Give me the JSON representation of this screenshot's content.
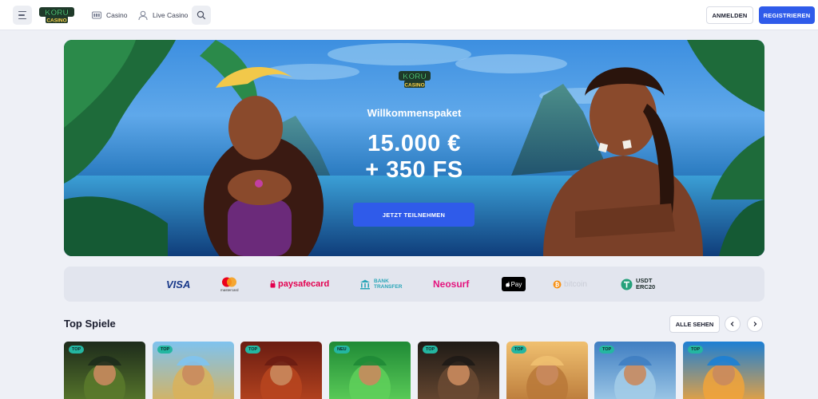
{
  "header": {
    "logo_text": "KORU CASINO",
    "nav": [
      {
        "label": "Casino",
        "icon": "slot-machine-icon"
      },
      {
        "label": "Live Casino",
        "icon": "dealer-icon"
      }
    ],
    "login_label": "ANMELDEN",
    "register_label": "REGISTRIEREN"
  },
  "hero": {
    "logo_text": "KORU CASINO",
    "subtitle": "Willkommenspaket",
    "amount": "15.000 €",
    "free_spins": "+ 350 FS",
    "cta_label": "JETZT TEILNEHMEN"
  },
  "payments": [
    {
      "name": "VISA"
    },
    {
      "name": "mastercard"
    },
    {
      "name": "paysafecard"
    },
    {
      "name": "BANK TRANSFER"
    },
    {
      "name": "Neosurf"
    },
    {
      "name": "Pay"
    },
    {
      "name": "bitcoin"
    },
    {
      "name": "USDT ERC20"
    }
  ],
  "top_games": {
    "title": "Top Spiele",
    "view_all_label": "ALLE SEHEN",
    "games": [
      {
        "badge": "TOP",
        "colors": [
          "#1d2b1b",
          "#5a7a2c"
        ]
      },
      {
        "badge": "TOP",
        "colors": [
          "#7fc3ef",
          "#d9b25a"
        ]
      },
      {
        "badge": "TOP",
        "colors": [
          "#6a1c12",
          "#b8451f"
        ]
      },
      {
        "badge": "NEU",
        "colors": [
          "#1f8a36",
          "#5fd05a"
        ]
      },
      {
        "badge": "TOP",
        "colors": [
          "#1e1a16",
          "#6b4a32"
        ]
      },
      {
        "badge": "TOP",
        "colors": [
          "#f0c070",
          "#b97838"
        ]
      },
      {
        "badge": "TOP",
        "colors": [
          "#3f7ec2",
          "#a3cce8"
        ]
      },
      {
        "badge": "TOP",
        "colors": [
          "#1c7fd4",
          "#f1a33a"
        ]
      }
    ]
  },
  "colors": {
    "accent": "#2f5bea",
    "badge": "#24b6a1",
    "background": "#eef0f6"
  }
}
